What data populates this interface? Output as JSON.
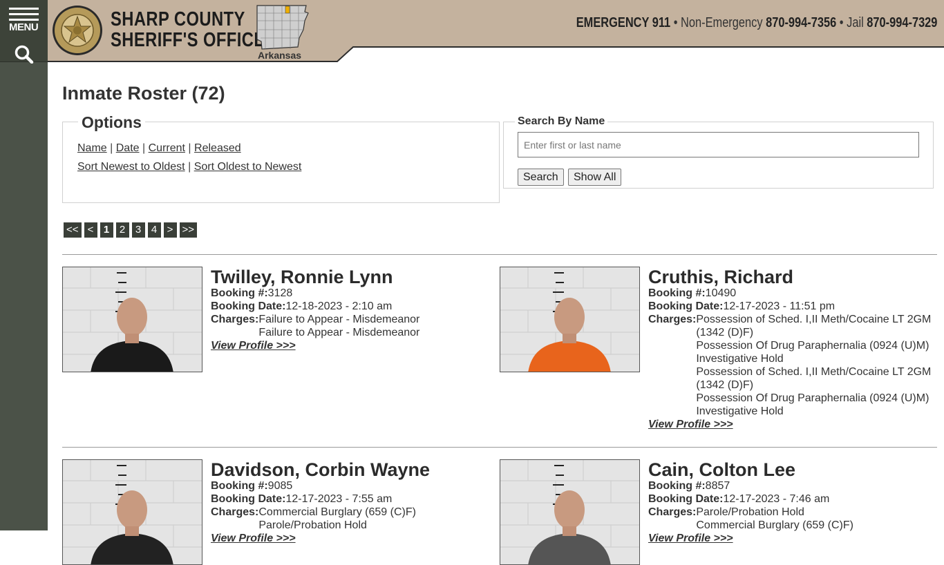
{
  "sidebar": {
    "menu_label": "MENU"
  },
  "header": {
    "title_line1": "SHARP COUNTY",
    "title_line2": "SHERIFF'S OFFICE",
    "badge_text_top": "SHARP COUNTY",
    "badge_text_bottom": "SHERIFF'S DEPARTMENT",
    "state_label": "Arkansas",
    "emergency_label": "EMERGENCY 911",
    "nonemergency_label": "Non-Emergency",
    "nonemergency_phone": "870-994-7356",
    "jail_label": "Jail",
    "jail_phone": "870-994-7329",
    "bullet": "•",
    "header_bg_color": "#c4b29e"
  },
  "page": {
    "title": "Inmate Roster (72)"
  },
  "options": {
    "legend": "Options",
    "sep": "|",
    "sort_name": "Name",
    "sort_date": "Date",
    "filter_current": "Current",
    "filter_released": "Released",
    "sort_newest": "Sort Newest to Oldest",
    "sort_oldest": "Sort Oldest to Newest"
  },
  "search": {
    "legend": "Search By Name",
    "placeholder": "Enter first or last name",
    "search_button": "Search",
    "show_all_button": "Show All"
  },
  "pager": [
    "<<",
    "<",
    "1",
    "2",
    "3",
    "4",
    ">",
    ">>"
  ],
  "pager_current": "1",
  "labels": {
    "booking_no": "Booking #:",
    "booking_date": "Booking Date:",
    "charges": "Charges:",
    "view_profile": "View Profile >>>"
  },
  "inmates": [
    {
      "name": "Twilley, Ronnie Lynn",
      "booking_no": "3128",
      "booking_date": "12-18-2023 - 2:10 am",
      "charges": [
        "Failure to Appear - Misdemeanor",
        "Failure to Appear - Misdemeanor"
      ],
      "shirt_color": "#1a1a1a"
    },
    {
      "name": "Cruthis, Richard",
      "booking_no": "10490",
      "booking_date": "12-17-2023 - 11:51 pm",
      "charges": [
        "Possession of Sched. I,II Meth/Cocaine LT 2GM (1342 (D)F)",
        "Possession Of Drug Paraphernalia (0924 (U)M)",
        "Investigative Hold",
        "Possession of Sched. I,II Meth/Cocaine LT 2GM (1342 (D)F)",
        "Possession Of Drug Paraphernalia (0924 (U)M)",
        "Investigative Hold"
      ],
      "shirt_color": "#e8641c"
    },
    {
      "name": "Davidson, Corbin Wayne",
      "booking_no": "9085",
      "booking_date": "12-17-2023 - 7:55 am",
      "charges": [
        "Commercial Burglary (659 (C)F)",
        "Parole/Probation Hold"
      ],
      "shirt_color": "#222222"
    },
    {
      "name": "Cain, Colton Lee",
      "booking_no": "8857",
      "booking_date": "12-17-2023 - 7:46 am",
      "charges": [
        "Parole/Probation Hold",
        "Commercial Burglary (659 (C)F)"
      ],
      "shirt_color": "#555555"
    }
  ]
}
